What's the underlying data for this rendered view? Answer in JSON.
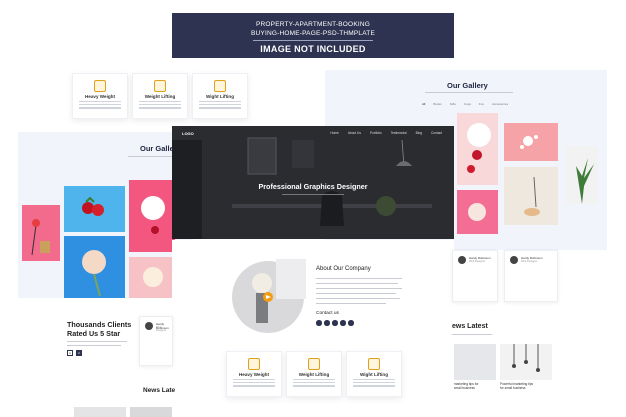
{
  "banner": {
    "line1": "PROPERTY-APARTMENT-BOOKING",
    "line2": "BUYING-HOME-PAGE-PSD-THMPLATE",
    "line3": "IMAGE NOT INCLUDED"
  },
  "services_top": [
    {
      "label": "Heavy Weight"
    },
    {
      "label": "Weight Lifting"
    },
    {
      "label": "Wight Lifting"
    }
  ],
  "gallery_right": {
    "title": "Our Gallery",
    "tabs": [
      "All",
      "Books",
      "Gifts",
      "Cups",
      "Fox",
      "Accessories"
    ]
  },
  "gallery_left": {
    "title": "Our Galle"
  },
  "hero": {
    "logo": "LOGO",
    "nav": [
      "Home",
      "About Us",
      "Portfolio",
      "Testimonial",
      "Blog",
      "Contact"
    ],
    "headline": "Professional Graphics Designer"
  },
  "about": {
    "title": "About Our Company",
    "contact_label": "Contact us"
  },
  "services_bottom": [
    {
      "label": "Heavy Weight"
    },
    {
      "label": "Weight Lifting"
    },
    {
      "label": "Wight Lifting"
    }
  ],
  "testimonials": {
    "heading_line1": "Thousands Clients",
    "heading_line2": "Rated Us 5 Star",
    "pages": [
      "1",
      "2"
    ],
    "cards": [
      {
        "name": "Hardy Robinson",
        "role": "Web Designer"
      },
      {
        "name": "Hardy Robinson",
        "role": "Web Designer"
      },
      {
        "name": "Hardy Robinson",
        "role": "Web Designer"
      }
    ]
  },
  "news": {
    "title_right": "ews Latest",
    "title_left": "News Late",
    "captions": [
      "marketing tips for",
      "Powerful marketing tips",
      "small business",
      "for small business"
    ]
  },
  "colors": {
    "navy": "#2d3350",
    "accent": "#e1a21a",
    "pink": "#f3567f",
    "blue": "#2f8fe0"
  }
}
